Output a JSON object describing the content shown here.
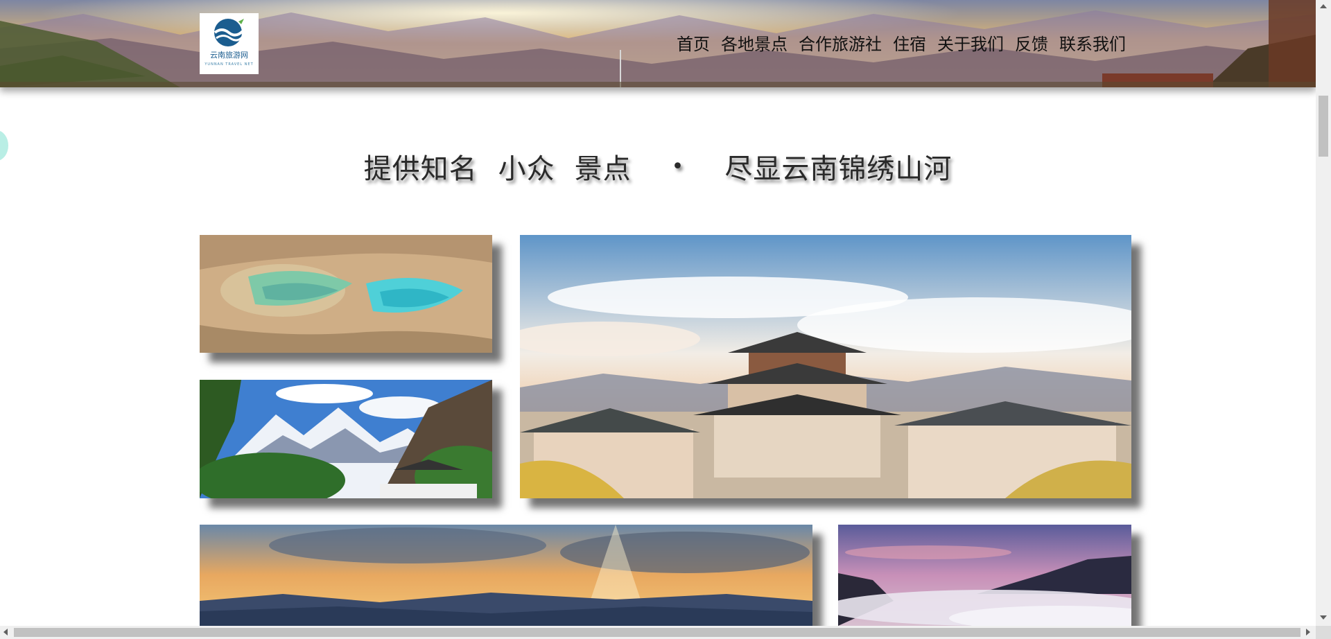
{
  "header": {
    "logo": {
      "name": "云南旅游网",
      "subtitle": "YUNNAN TRAVEL NET",
      "icon": "wave-globe-icon"
    },
    "nav": [
      {
        "label": "首页"
      },
      {
        "label": "各地景点"
      },
      {
        "label": "合作旅游社"
      },
      {
        "label": "住宿"
      },
      {
        "label": "关于我们"
      },
      {
        "label": "反馈"
      },
      {
        "label": "联系我们"
      }
    ]
  },
  "slogan": {
    "part1": "提供知名",
    "part2": "小众",
    "part3": "景点",
    "separator": "•",
    "part4": "尽显云南锦绣山河"
  },
  "gallery": [
    {
      "name": "terrace-pools-photo"
    },
    {
      "name": "temple-town-photo"
    },
    {
      "name": "snow-mountain-photo"
    },
    {
      "name": "sunset-mountains-photo"
    },
    {
      "name": "sea-of-clouds-photo"
    }
  ],
  "colors": {
    "nav_text": "#111111",
    "slogan_text": "#2a2a2a",
    "logo_blue": "#1b5d8f"
  }
}
